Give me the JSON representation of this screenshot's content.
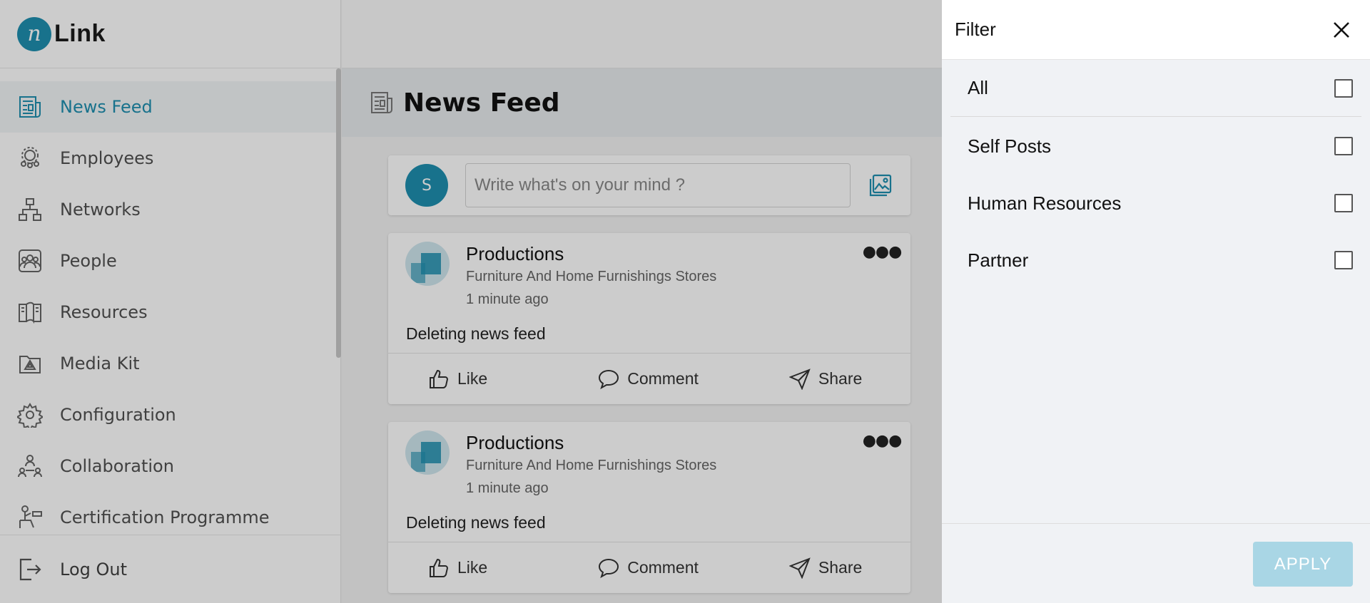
{
  "brand": {
    "mark": "n",
    "name": "Link"
  },
  "sidebar": {
    "items": [
      {
        "label": "News Feed",
        "icon": "newspaper-icon",
        "active": true
      },
      {
        "label": "Employees",
        "icon": "employees-icon"
      },
      {
        "label": "Networks",
        "icon": "network-icon"
      },
      {
        "label": "People",
        "icon": "people-icon"
      },
      {
        "label": "Resources",
        "icon": "book-icon"
      },
      {
        "label": "Media Kit",
        "icon": "media-kit-icon"
      },
      {
        "label": "Configuration",
        "icon": "gear-icon"
      },
      {
        "label": "Collaboration",
        "icon": "collaboration-icon"
      },
      {
        "label": "Certification Programme",
        "icon": "certification-icon"
      }
    ],
    "logout": {
      "label": "Log Out",
      "icon": "logout-icon"
    }
  },
  "header": {
    "title": "News Feed",
    "icon": "newspaper-icon"
  },
  "composer": {
    "avatar_initial": "S",
    "placeholder": "Write what's on your mind ?",
    "media_icon": "image-gallery-icon"
  },
  "posts": [
    {
      "author": "Productions",
      "category": "Furniture And Home Furnishings Stores",
      "time": "1 minute ago",
      "body": "Deleting news feed",
      "actions": {
        "like": "Like",
        "comment": "Comment",
        "share": "Share"
      }
    },
    {
      "author": "Productions",
      "category": "Furniture And Home Furnishings Stores",
      "time": "1 minute ago",
      "body": "Deleting news feed",
      "actions": {
        "like": "Like",
        "comment": "Comment",
        "share": "Share"
      }
    }
  ],
  "filter": {
    "title": "Filter",
    "options": [
      {
        "label": "All",
        "checked": false
      },
      {
        "label": "Self Posts",
        "checked": false
      },
      {
        "label": "Human Resources",
        "checked": false
      },
      {
        "label": "Partner",
        "checked": false
      }
    ],
    "apply_label": "APPLY"
  },
  "colors": {
    "accent": "#1f8fb0",
    "apply_button": "#a9d6e5"
  }
}
